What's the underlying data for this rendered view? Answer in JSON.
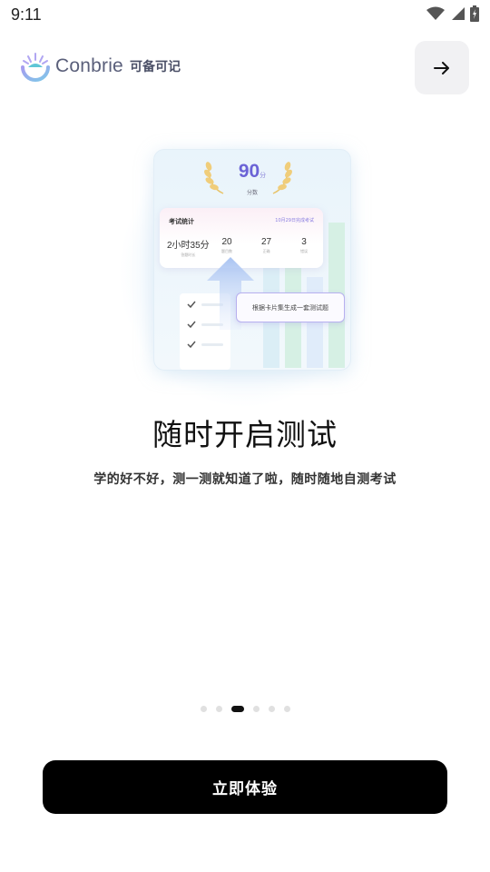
{
  "status_bar": {
    "time": "9:11"
  },
  "header": {
    "brand_en": "Conbrie",
    "brand_cn": "可备可记",
    "skip_icon": "arrow-right-icon"
  },
  "illustration": {
    "score": "90",
    "score_unit": "分",
    "score_label": "分数",
    "stats_title": "考试统计",
    "stats_date": "10月29日完成考试",
    "stats": [
      {
        "value": "2小时35分",
        "label": "答题时长"
      },
      {
        "value": "20",
        "label": "题目数"
      },
      {
        "value": "27",
        "label": "正确"
      },
      {
        "value": "3",
        "label": "错误"
      }
    ],
    "tooltip": "根据卡片集生成一套测试题"
  },
  "content": {
    "title": "随时开启测试",
    "subtitle": "学的好不好，测一测就知道了啦，随时随地自测考试"
  },
  "pagination": {
    "total": 6,
    "active_index": 2
  },
  "cta": {
    "label": "立即体验"
  },
  "colors": {
    "accent": "#6b63d6",
    "cta_bg": "#000000",
    "dot_active": "#111111",
    "dot_inactive": "#e0e0e0"
  }
}
